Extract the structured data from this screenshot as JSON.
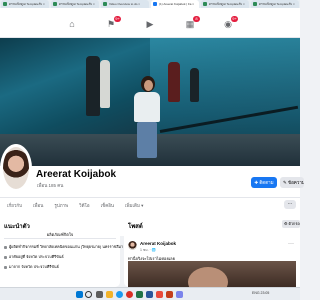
{
  "browser": {
    "tabs": [
      {
        "label": "ดรรมเปิลดูเอ Templateรับ ×",
        "active": false
      },
      {
        "label": "ดรรมเปิลดูเอ Templateรับ ×",
        "active": false
      },
      {
        "label": "Video Overview to do ×",
        "active": false
      },
      {
        "label": "(1) Areerat Koijabok | Fa ×",
        "active": true
      },
      {
        "label": "ดรรมเปิลดูเอ Templateรับ ×",
        "active": false
      },
      {
        "label": "ดรรมเปิลดูเอ Templateรับ ×",
        "active": false
      }
    ]
  },
  "nav": {
    "icons": [
      {
        "name": "home-icon",
        "glyph": "⌂",
        "badge": ""
      },
      {
        "name": "flag-icon",
        "glyph": "⚑",
        "badge": "9+"
      },
      {
        "name": "video-icon",
        "glyph": "▶",
        "badge": ""
      },
      {
        "name": "marketplace-icon",
        "glyph": "▦",
        "badge": "8"
      },
      {
        "name": "groups-icon",
        "glyph": "◉",
        "badge": "9+"
      }
    ]
  },
  "profile": {
    "name": "Areerat Koijabok",
    "friends": "เพื่อน 185 คน",
    "primary_button": "✚ ติดตาม",
    "secondary_button": "✎ ข้อความ"
  },
  "profile_tabs": [
    {
      "label": "เกี่ยวกับ",
      "active": false
    },
    {
      "label": "เพื่อน",
      "active": false
    },
    {
      "label": "รูปภาพ",
      "active": false
    },
    {
      "label": "วิดีโอ",
      "active": false
    },
    {
      "label": "เช็คอิน",
      "active": false
    },
    {
      "label": "เพิ่มเติม ▾",
      "active": false
    }
  ],
  "intro": {
    "title": "แนะนำตัว",
    "subtitle": "ผลิตภัณฑ์กิตใจ",
    "lines": [
      "ผู้ผลิตทำกิจกรรมที่ วิทยาลัยเทคนิคขอนแก่น (วิทยุยรมาย) นครราชสีมา",
      "อาศัยอยู่ที่ จังหวัด ประจวบคีรีขันธ์",
      "มาจาก จังหวัด ประจวบคีรีขันธ์"
    ]
  },
  "posts": {
    "title": "โพสต์",
    "filter_button": "⚙ ตัวกรอง",
    "post": {
      "author": "Areerat Koijabok",
      "time": "1 ชม. · 🌐",
      "text": "ท่านี่จริงจะใส่เราไม่ค่อยเลย"
    }
  },
  "taskbar": {
    "clock": "ENG  23:05"
  }
}
